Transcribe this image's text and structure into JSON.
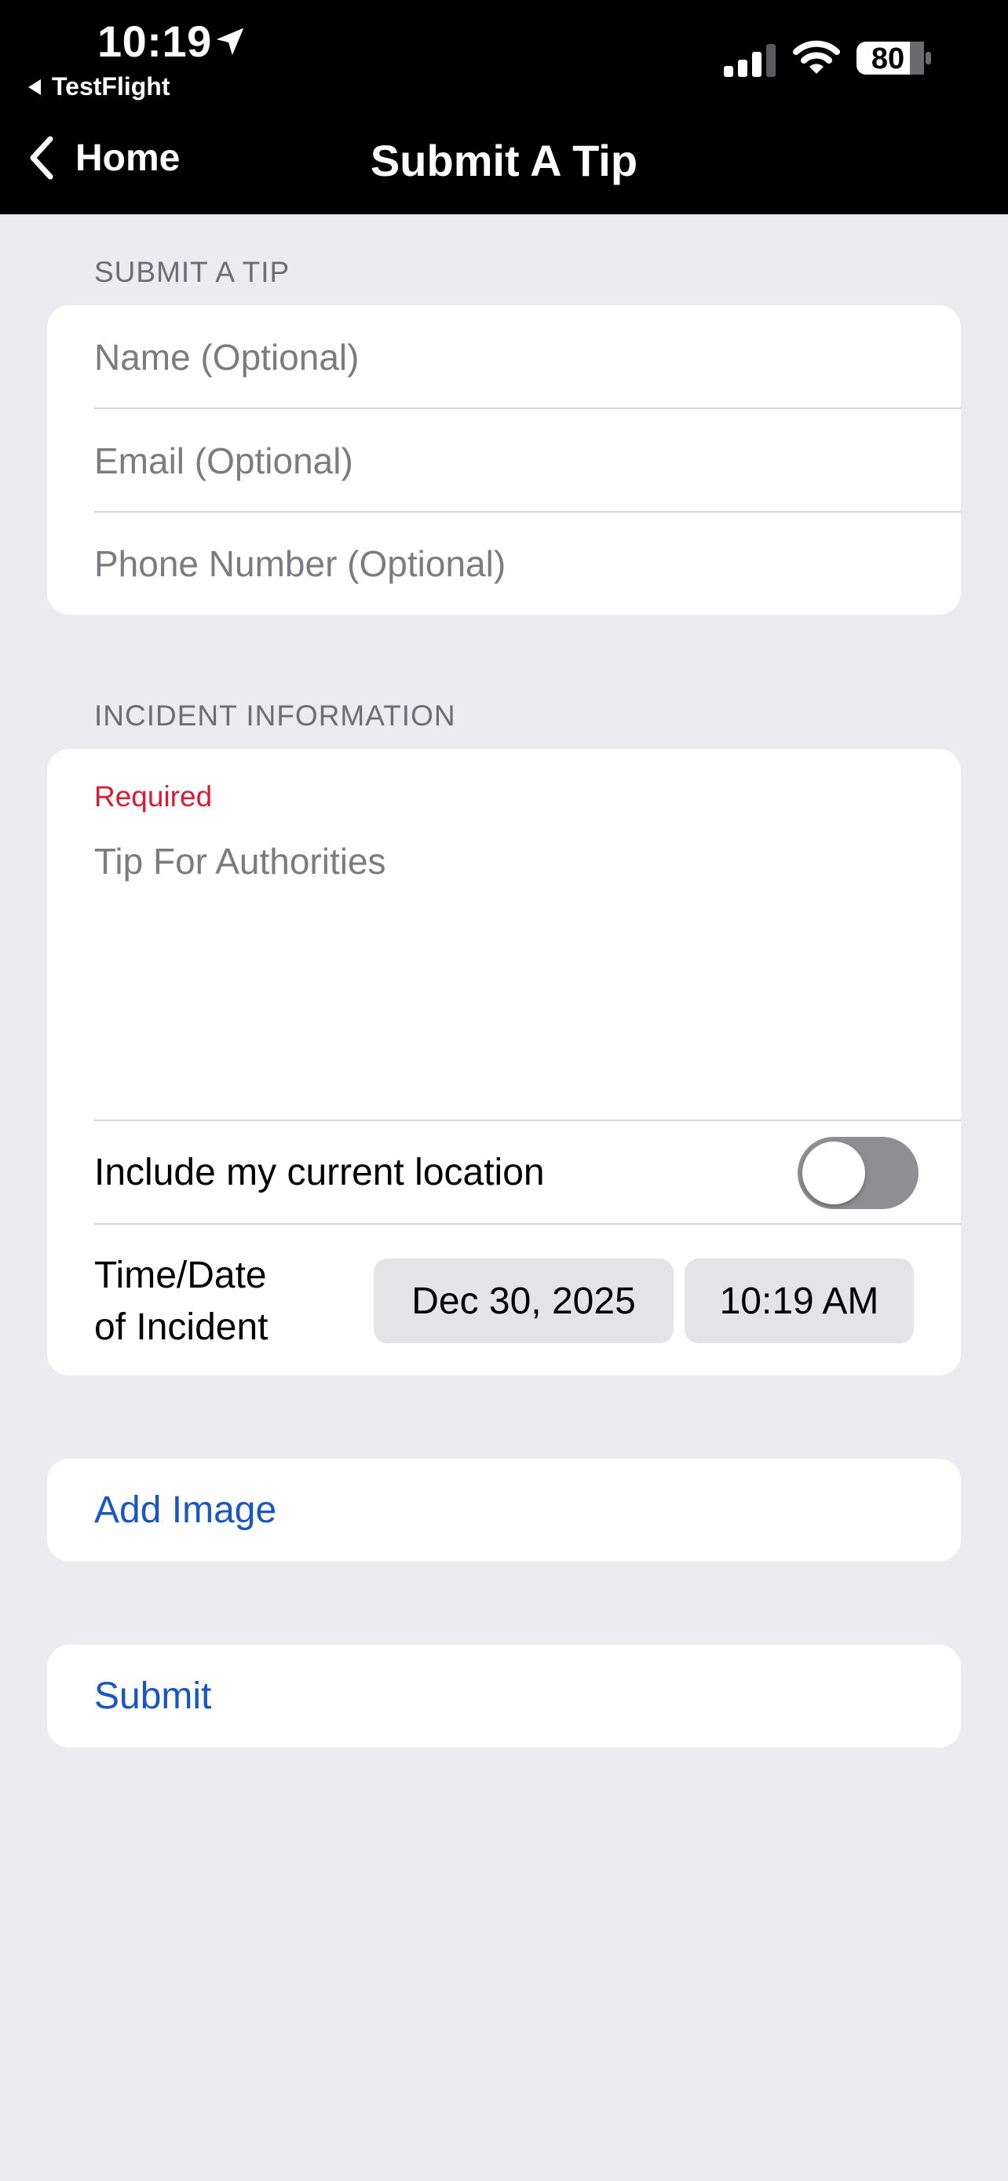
{
  "status_bar": {
    "time": "10:19",
    "back_app": "TestFlight",
    "battery": "80",
    "icons": [
      "location-arrow-icon",
      "cellular-signal-icon",
      "wifi-icon",
      "battery-icon"
    ]
  },
  "nav": {
    "back_label": "Home",
    "title": "Submit A Tip"
  },
  "contact_section": {
    "header": "SUBMIT A TIP",
    "name_placeholder": "Name (Optional)",
    "email_placeholder": "Email (Optional)",
    "phone_placeholder": "Phone Number (Optional)"
  },
  "incident_section": {
    "header": "INCIDENT INFORMATION",
    "required_label": "Required",
    "tip_placeholder": "Tip For Authorities",
    "location_label": "Include my current location",
    "location_enabled": false,
    "datetime_label_line1": "Time/Date",
    "datetime_label_line2": "of Incident",
    "date_value": "Dec 30, 2025",
    "time_value": "10:19 AM"
  },
  "actions": {
    "add_image": "Add Image",
    "submit": "Submit"
  },
  "colors": {
    "background": "#ebebf0",
    "header": "#000000",
    "link": "#1a56c0",
    "required": "#d71c34",
    "toggle_off": "#8e8e93"
  }
}
